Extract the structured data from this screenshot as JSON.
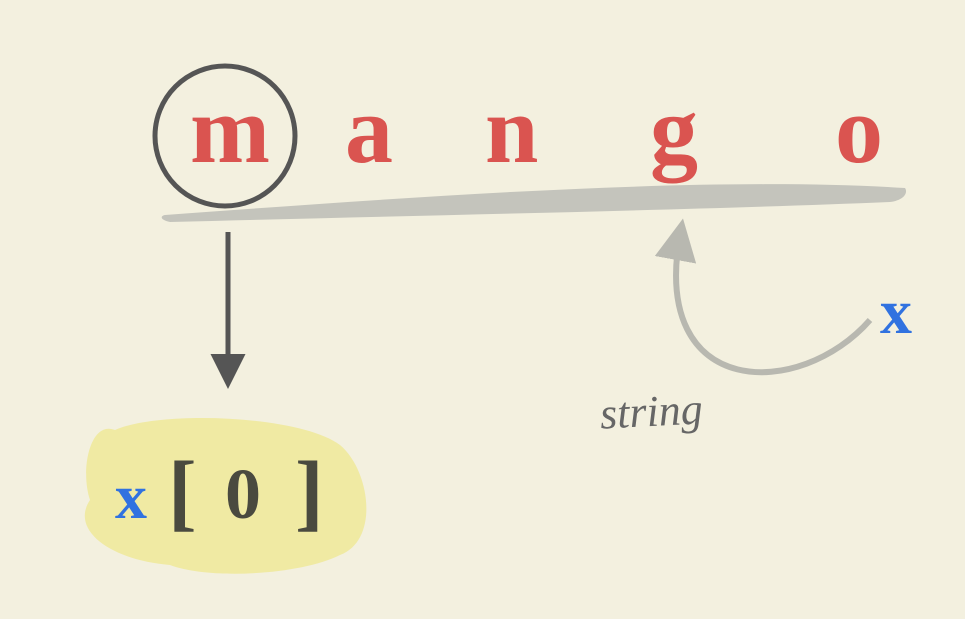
{
  "letters": [
    "m",
    "a",
    "n",
    "g",
    "o"
  ],
  "variable": "x",
  "index_expr": {
    "x": "x",
    "lb": "[",
    "zero": "0",
    "rb": "]"
  },
  "annotation": "string",
  "colors": {
    "bg": "#f3f0df",
    "letter": "#da5450",
    "var": "#3072e0",
    "ink": "#4a4a3f",
    "stroke": "#666",
    "grey": "#b8b8b0",
    "note": "#666",
    "highlight": "#efe999"
  }
}
